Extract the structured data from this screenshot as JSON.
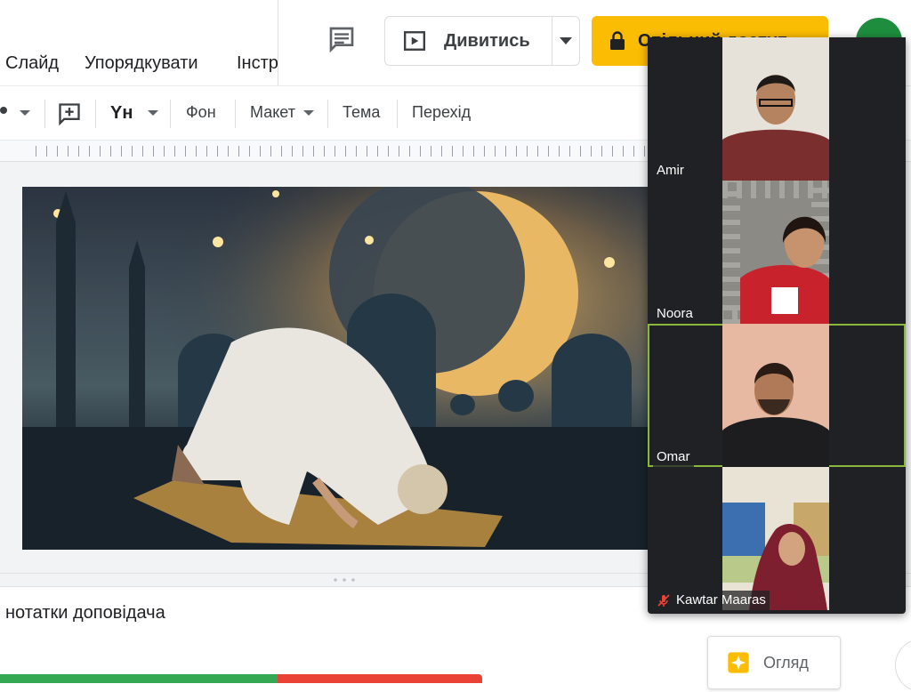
{
  "menu": {
    "items": [
      "Слайд",
      "Упорядкувати",
      "Інстр"
    ]
  },
  "header": {
    "comments_icon": "comment-icon",
    "watch_label": "Дивитись",
    "share_label": "Спільний доступ",
    "share_icon": "lock-icon"
  },
  "toolbar": {
    "background_label": "Фон",
    "layout_label": "Макет",
    "theme_label": "Тема",
    "transition_label": "Перехід"
  },
  "notes": {
    "placeholder": "нотатки доповідача"
  },
  "explore": {
    "label": "Огляд"
  },
  "participants": [
    {
      "name": "Amir",
      "muted": false,
      "active": false
    },
    {
      "name": "Noora",
      "muted": false,
      "active": false
    },
    {
      "name": "Omar",
      "muted": false,
      "active": true
    },
    {
      "name": "Kawtar Maaras",
      "muted": true,
      "active": false
    }
  ],
  "colors": {
    "share_button": "#fbbc04",
    "active_speaker_outline": "#8ab83c",
    "avatar": "#1e8e3e",
    "muted_icon": "#ea4335"
  }
}
